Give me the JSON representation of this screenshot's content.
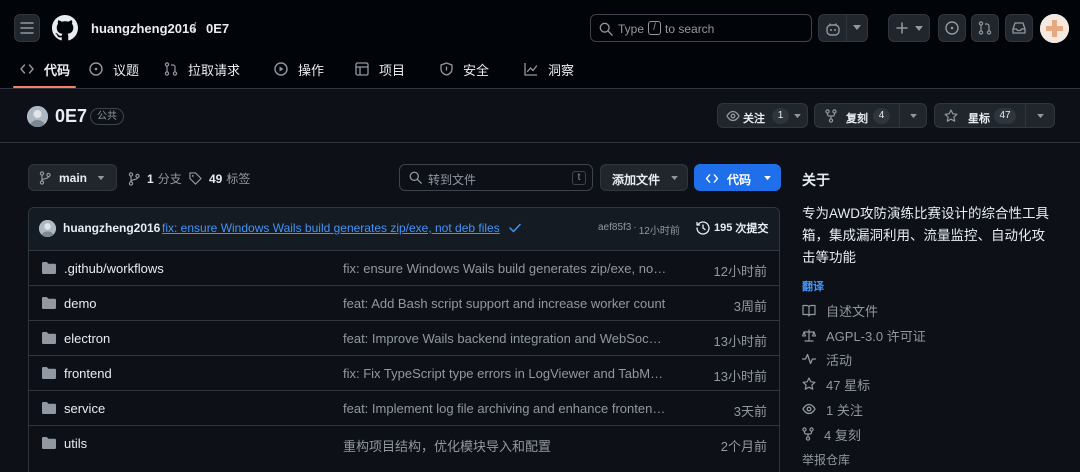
{
  "header": {
    "owner": "huangzheng2016",
    "separator": "/",
    "repo": "0E7",
    "search_placeholder_pre": "Type",
    "search_key": "/",
    "search_placeholder_post": "to search"
  },
  "tabs": [
    {
      "label": "代码",
      "icon": "code-icon",
      "active": true
    },
    {
      "label": "议题",
      "icon": "issue-icon"
    },
    {
      "label": "拉取请求",
      "icon": "pull-request-icon"
    },
    {
      "label": "操作",
      "icon": "play-icon"
    },
    {
      "label": "项目",
      "icon": "table-icon"
    },
    {
      "label": "安全",
      "icon": "shield-icon"
    },
    {
      "label": "洞察",
      "icon": "graph-icon"
    }
  ],
  "repo": {
    "name": "0E7",
    "visibility": "公共",
    "watch_label": "关注",
    "watch_count": "1",
    "fork_label": "复刻",
    "fork_count": "4",
    "star_label": "星标",
    "star_count": "47"
  },
  "toolbar": {
    "branch": "main",
    "branches_count": "1",
    "branches_label": "分支",
    "tags_count": "49",
    "tags_label": "标签",
    "goto_placeholder": "转到文件",
    "goto_key": "t",
    "add_file": "添加文件",
    "code": "代码"
  },
  "commit": {
    "author": "huangzheng2016",
    "message": "fix: ensure Windows Wails build generates zip/exe, not deb files",
    "hash": "aef85f3",
    "dot": "·",
    "time": "12小时前",
    "count": "195",
    "count_label": "次提交"
  },
  "files": [
    {
      "name": ".github/workflows",
      "message": "fix: ensure Windows Wails build generates zip/exe, not deb files",
      "time": "12小时前"
    },
    {
      "name": "demo",
      "message": "feat: Add Bash script support and increase worker count",
      "time": "3周前"
    },
    {
      "name": "electron",
      "message": "feat: Improve Wails backend integration and WebSocket handling",
      "time": "13小时前"
    },
    {
      "name": "frontend",
      "message": "fix: Fix TypeScript type errors in LogViewer and TabManager",
      "time": "13小时前"
    },
    {
      "name": "service",
      "message": "feat: Implement log file archiving and enhance frontend components",
      "time": "3天前"
    },
    {
      "name": "utils",
      "message": "重构项目结构，优化模块导入和配置",
      "time": "2个月前"
    }
  ],
  "about": {
    "title": "关于",
    "description": "专为AWD攻防演练比赛设计的综合性工具箱，集成漏洞利用、流量监控、自动化攻击等功能",
    "translate": "翻译",
    "readme": "自述文件",
    "license": "AGPL-3.0 许可证",
    "activity": "活动",
    "stars": "47 星标",
    "watching": "1 关注",
    "forks": "4 复刻",
    "report": "举报仓库"
  },
  "colors": {
    "bg": "#0d1117",
    "header_bg": "#010409",
    "accent_blue": "#1f6feb",
    "link": "#4493f8",
    "active_tab_underline": "#f78166"
  }
}
